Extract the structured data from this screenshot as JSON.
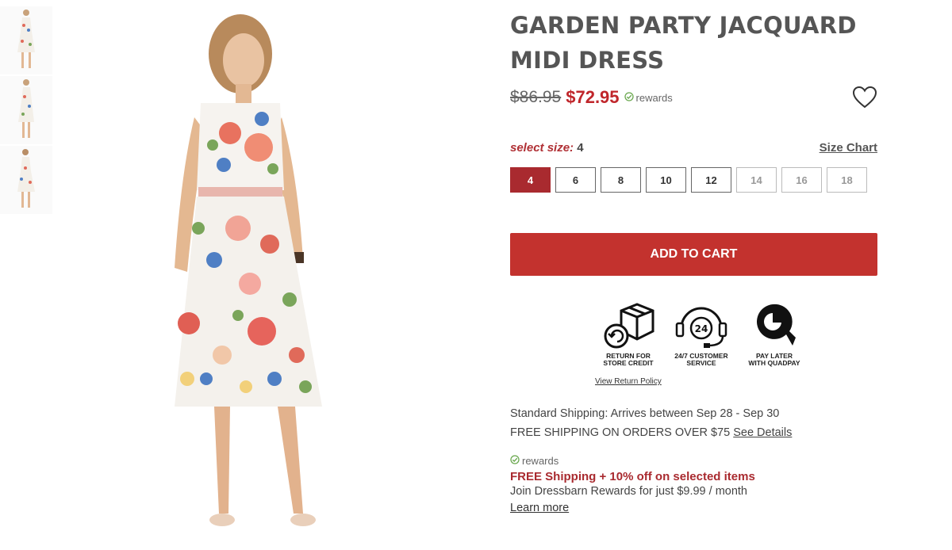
{
  "product": {
    "title_line1": "GARDEN PARTY JACQUARD",
    "title_line2": "MIDI DRESS",
    "price_original": "$86.95",
    "price_sale": "$72.95",
    "rewards_badge": "rewards"
  },
  "size_selector": {
    "label": "select size:",
    "selected": "4",
    "size_chart_link": "Size Chart",
    "sizes": [
      {
        "label": "4",
        "state": "selected"
      },
      {
        "label": "6",
        "state": "available"
      },
      {
        "label": "8",
        "state": "available"
      },
      {
        "label": "10",
        "state": "available"
      },
      {
        "label": "12",
        "state": "available"
      },
      {
        "label": "14",
        "state": "unavailable"
      },
      {
        "label": "16",
        "state": "unavailable"
      },
      {
        "label": "18",
        "state": "unavailable"
      }
    ]
  },
  "cart": {
    "add_to_cart_label": "ADD TO CART"
  },
  "features": [
    {
      "icon": "return-box-icon",
      "line1": "RETURN FOR",
      "line2": "STORE CREDIT"
    },
    {
      "icon": "headset-24-icon",
      "line1": "24/7 CUSTOMER",
      "line2": "SERVICE"
    },
    {
      "icon": "quadpay-logo-icon",
      "line1": "PAY LATER",
      "line2": "WITH QUADPAY"
    }
  ],
  "return_policy_link": "View Return Policy",
  "shipping": {
    "standard": "Standard Shipping: Arrives between Sep 28 - Sep 30",
    "free_threshold": "FREE SHIPPING ON ORDERS OVER $75",
    "see_details": "See Details"
  },
  "rewards_program": {
    "label": "rewards",
    "promo": "FREE Shipping + 10% off on selected items",
    "join_text": "Join Dressbarn Rewards for just $9.99 / month",
    "learn_more": "Learn more"
  },
  "colors": {
    "brand_red": "#c3322e",
    "selected_size": "#a92a2f",
    "rewards_check": "#6aa84f"
  }
}
